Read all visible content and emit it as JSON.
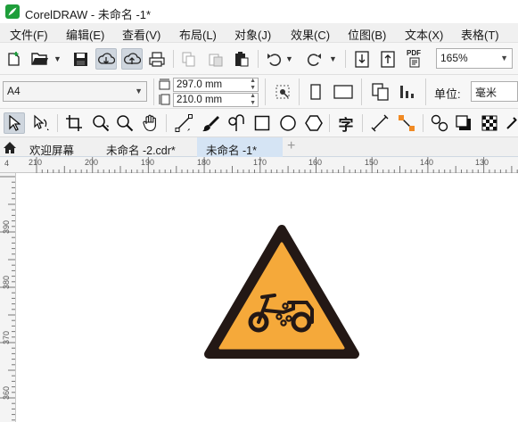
{
  "window": {
    "title": "CorelDRAW - 未命名 -1*",
    "brand_color": "#1e9e3a"
  },
  "menu": {
    "items": [
      "文件(F)",
      "编辑(E)",
      "查看(V)",
      "布局(L)",
      "对象(J)",
      "效果(C)",
      "位图(B)",
      "文本(X)",
      "表格(T)"
    ]
  },
  "toolbar": {
    "icons": [
      "new-document-icon",
      "open-folder-icon",
      "save-icon",
      "cloud-download-icon",
      "cloud-upload-icon",
      "print-icon",
      "copy-icon",
      "paste-icon",
      "clipboard-icon",
      "undo-icon",
      "redo-icon",
      "import-icon",
      "export-icon",
      "pdf-icon"
    ],
    "pdf_label": "PDF",
    "zoom": "165%"
  },
  "properties": {
    "page_size": "A4",
    "width": "297.0 mm",
    "height": "210.0 mm",
    "units_label": "单位:",
    "units_value": "毫米"
  },
  "toolbox": {
    "text_tool_glyph": "字",
    "icons": [
      "pick-tool-icon",
      "shape-tool-icon",
      "crop-tool-icon",
      "zoom-tool-icon",
      "zoom-out-icon",
      "pan-tool-icon",
      "freehand-tool-icon",
      "artistic-media-icon",
      "spiral-tool-icon",
      "rectangle-tool-icon",
      "ellipse-tool-icon",
      "polygon-tool-icon",
      "text-tool-icon",
      "dimension-tool-icon",
      "connector-tool-icon",
      "blend-tool-icon",
      "drop-shadow-icon",
      "transparency-icon"
    ]
  },
  "tabs": {
    "items": [
      "欢迎屏幕",
      "未命名 -2.cdr*",
      "未命名 -1*"
    ],
    "add_label": "+",
    "active_index": 2
  },
  "rulers": {
    "horizontal": [
      "210",
      "200",
      "190",
      "180",
      "170",
      "160",
      "150",
      "140",
      "130"
    ],
    "vertical": [
      "390",
      "380",
      "370",
      "360"
    ],
    "corner": "4"
  },
  "sign": {
    "symbol": "motorcycle-icon",
    "fill_color": "#f5a93a",
    "border_color": "#231815"
  }
}
